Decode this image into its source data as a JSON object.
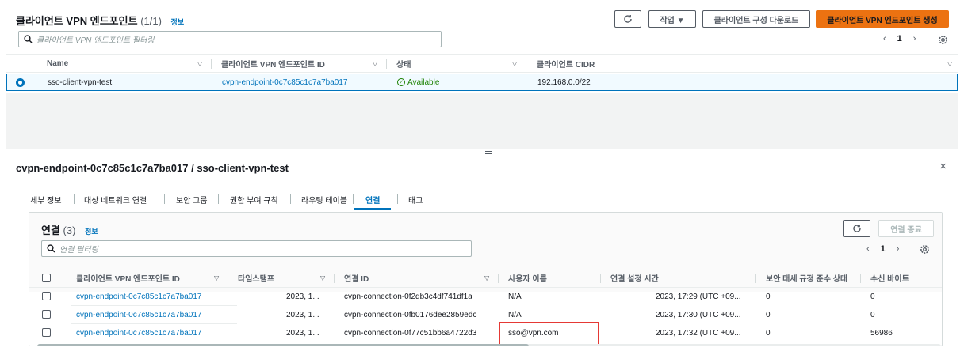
{
  "top": {
    "title": "클라이언트 VPN 엔드포인트",
    "count": "(1/1)",
    "info": "정보",
    "refresh_icon": "refresh-icon",
    "actions_label": "작업 ▼",
    "download_label": "클라이언트 구성 다운로드",
    "create_label": "클라이언트 VPN 엔드포인트 생성",
    "search_placeholder": "클라이언트 VPN 엔드포인트 필터링",
    "pager": {
      "prev": "‹",
      "page": "1",
      "next": "›"
    },
    "columns": [
      "Name",
      "클라이언트 VPN 엔드포인트 ID",
      "상태",
      "클라이언트 CIDR"
    ],
    "row": {
      "name": "sso-client-vpn-test",
      "endpoint_id": "cvpn-endpoint-0c7c85c1c7a7ba017",
      "status": "Available",
      "cidr": "192.168.0.0/22"
    }
  },
  "detail": {
    "title": "cvpn-endpoint-0c7c85c1c7a7ba017 / sso-client-vpn-test",
    "close": "×",
    "tabs": [
      "세부 정보",
      "대상 네트워크 연결",
      "보안 그룹",
      "권한 부여 규칙",
      "라우팅 테이블",
      "연결",
      "태그"
    ],
    "active_tab": "연결"
  },
  "connections": {
    "title": "연결",
    "count": "(3)",
    "info": "정보",
    "terminate_label": "연결 종료",
    "search_placeholder": "연결 필터링",
    "pager": {
      "prev": "‹",
      "page": "1",
      "next": "›"
    },
    "columns": [
      "클라이언트 VPN 엔드포인트 ID",
      "타임스탬프",
      "연결 ID",
      "사용자 이름",
      "연결 설정 시간",
      "보안 태세 규정 준수 상태",
      "수신 바이트"
    ],
    "rows": [
      {
        "endpoint_id": "cvpn-endpoint-0c7c85c1c7a7ba017",
        "timestamp": "2023, 1...",
        "connection_id": "cvpn-connection-0f2db3c4df741df1a",
        "username": "N/A",
        "established": "2023, 17:29 (UTC +09...",
        "posture": "0",
        "bytes": "0"
      },
      {
        "endpoint_id": "cvpn-endpoint-0c7c85c1c7a7ba017",
        "timestamp": "2023, 1...",
        "connection_id": "cvpn-connection-0fb0176dee2859edc",
        "username": "N/A",
        "established": "2023, 17:30 (UTC +09...",
        "posture": "0",
        "bytes": "0"
      },
      {
        "endpoint_id": "cvpn-endpoint-0c7c85c1c7a7ba017",
        "timestamp": "2023, 1...",
        "connection_id": "cvpn-connection-0f77c51bb6a4722d3",
        "username": "sso@vpn.com",
        "established": "2023, 17:32 (UTC +09...",
        "posture": "0",
        "bytes": "56986"
      }
    ]
  },
  "colors": {
    "link": "#0073bb",
    "primary": "#ec7211",
    "success": "#1d8102",
    "highlight": "#e53935"
  }
}
